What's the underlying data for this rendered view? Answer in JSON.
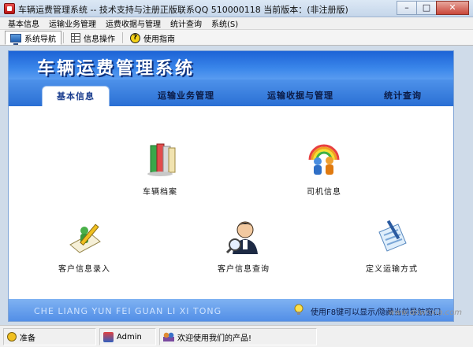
{
  "window": {
    "title": "车辆运费管理系统 -- 技术支持与注册正版联系QQ 510000118    当前版本：(非注册版)",
    "buttons": {
      "minimize": "–",
      "maximize": "□",
      "close": "✕"
    }
  },
  "menu": [
    "基本信息",
    "运输业务管理",
    "运费收据与管理",
    "统计查询",
    "系统(S)"
  ],
  "toolbar": {
    "tabs": [
      {
        "label": "系统导航",
        "icon": "monitor-icon"
      },
      {
        "label": "信息操作",
        "icon": "grid-icon"
      },
      {
        "label": "使用指南",
        "icon": "help-icon"
      }
    ]
  },
  "banner": {
    "title": "车辆运费管理系统"
  },
  "nav": {
    "tabs": [
      "基本信息",
      "运输业务管理",
      "运输收据与管理",
      "统计查询"
    ],
    "active_index": 0
  },
  "tiles": [
    {
      "label": "车辆档案",
      "icon": "books-icon"
    },
    {
      "label": "司机信息",
      "icon": "people-rainbow-icon"
    },
    {
      "label": "客户信息录入",
      "icon": "pencil-paper-icon"
    },
    {
      "label": "客户信息查询",
      "icon": "user-search-icon"
    },
    {
      "label": "定义运输方式",
      "icon": "document-pen-icon"
    }
  ],
  "footer": {
    "pinyin": "CHE LIANG YUN FEI GUAN LI XI TONG",
    "hint": "使用F8键可以显示/隐藏当前导航窗口"
  },
  "status": {
    "ready": "准备",
    "user": "Admin",
    "welcome": "欢迎使用我们的产品!"
  },
  "watermark": "www.downxia.com",
  "colors": {
    "banner": "#1c63d6",
    "nav_band": "#2a6fd4",
    "footer_band": "#4f8ce6"
  }
}
